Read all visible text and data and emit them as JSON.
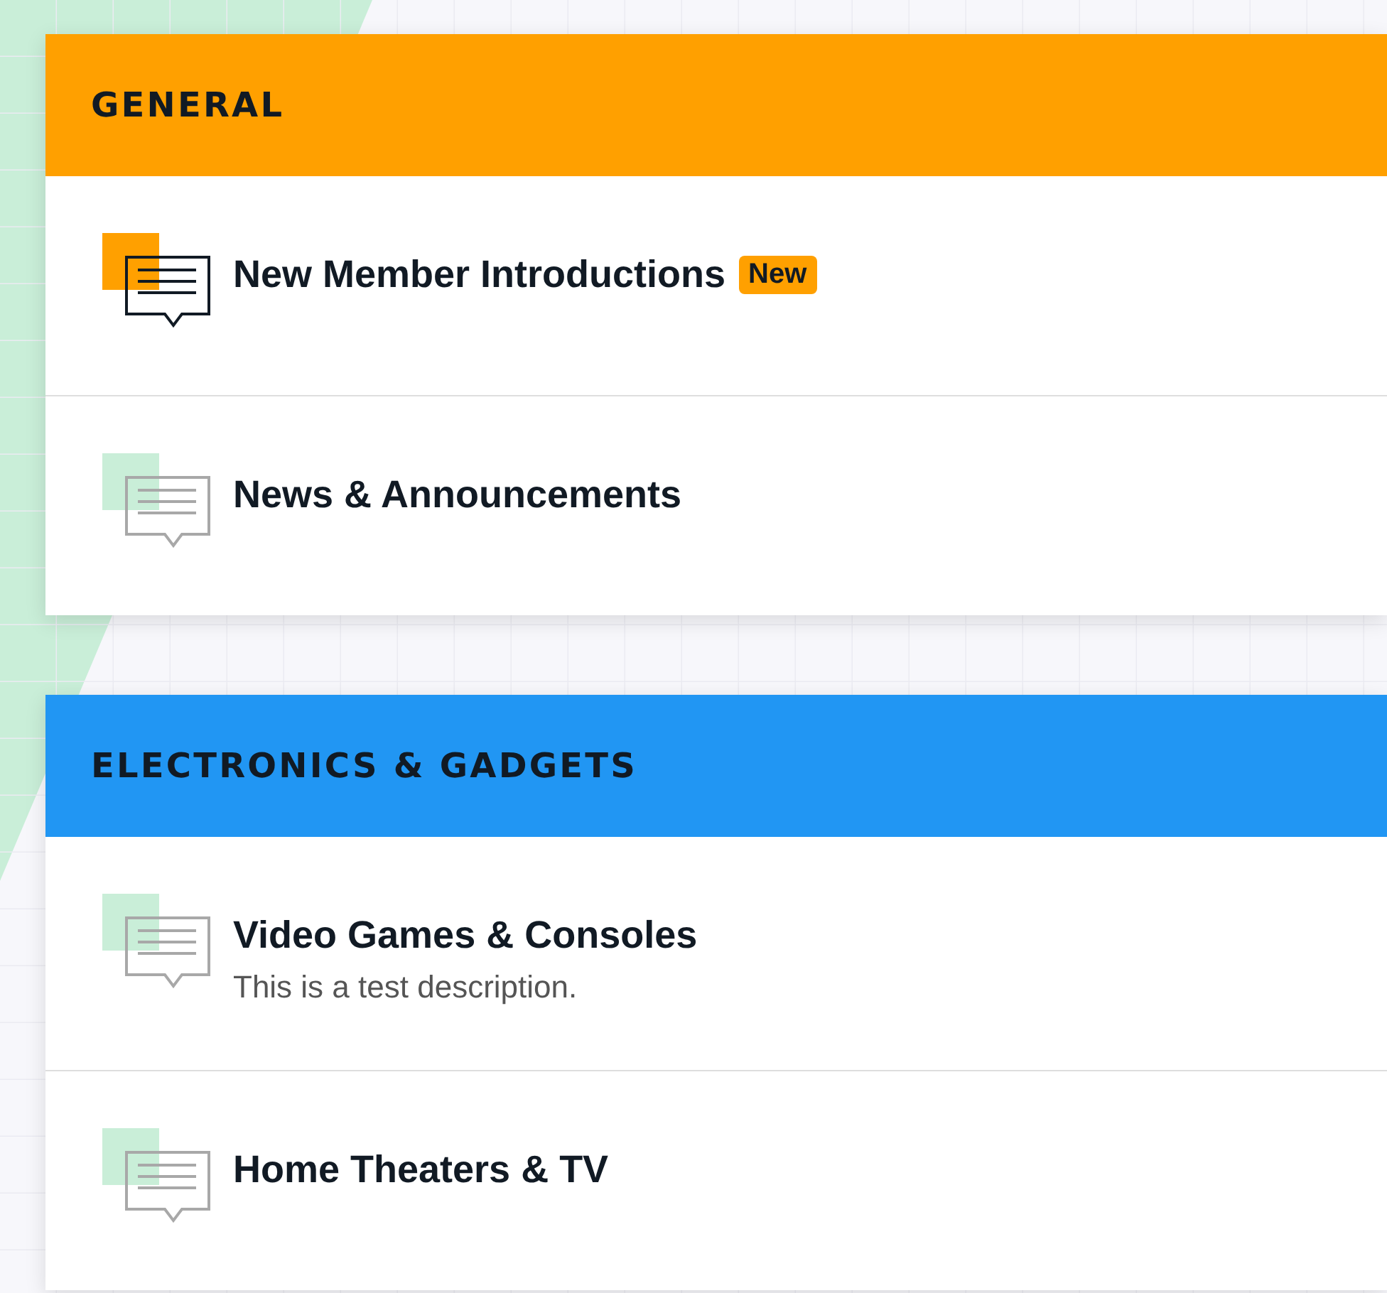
{
  "categories": [
    {
      "title": "GENERAL",
      "color": "#ffa000",
      "forums": [
        {
          "title": "New Member Introductions",
          "unread": true,
          "badge": "New"
        },
        {
          "title": "News & Announcements",
          "unread": false
        }
      ]
    },
    {
      "title": "ELECTRONICS & GADGETS",
      "color": "#2196f3",
      "forums": [
        {
          "title": "Video Games & Consoles",
          "unread": false,
          "description": "This is a test description."
        },
        {
          "title": "Home Theaters & TV",
          "unread": false
        }
      ]
    }
  ]
}
